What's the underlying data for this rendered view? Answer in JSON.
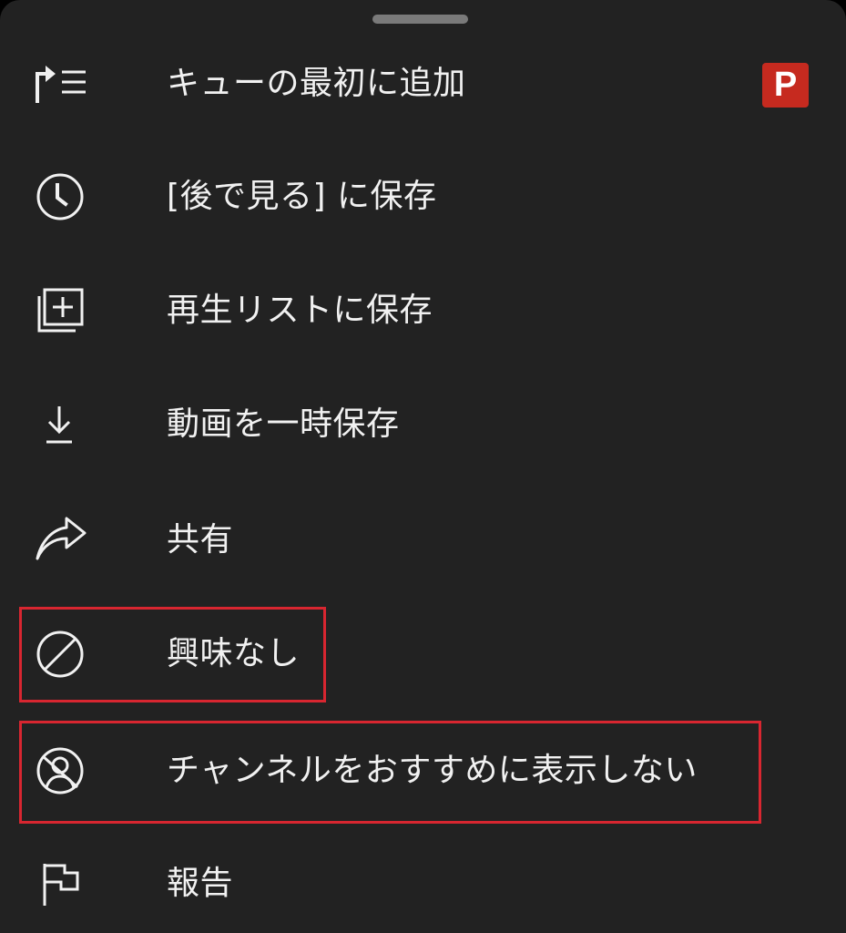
{
  "menu": {
    "items": [
      {
        "label": "キューの最初に追加",
        "icon": "play-next-queue-icon"
      },
      {
        "label": "[後で見る] に保存",
        "icon": "clock-icon"
      },
      {
        "label": "再生リストに保存",
        "icon": "add-to-playlist-icon"
      },
      {
        "label": "動画を一時保存",
        "icon": "download-icon"
      },
      {
        "label": "共有",
        "icon": "share-icon"
      },
      {
        "label": "興味なし",
        "icon": "not-interested-icon"
      },
      {
        "label": "チャンネルをおすすめに表示しない",
        "icon": "dont-recommend-channel-icon"
      },
      {
        "label": "報告",
        "icon": "flag-icon"
      }
    ]
  },
  "badge": {
    "letter": "P",
    "color": "#c62a1f"
  },
  "colors": {
    "sheet_background": "#222222",
    "text": "#f1f1f1",
    "highlight": "#d82630"
  }
}
